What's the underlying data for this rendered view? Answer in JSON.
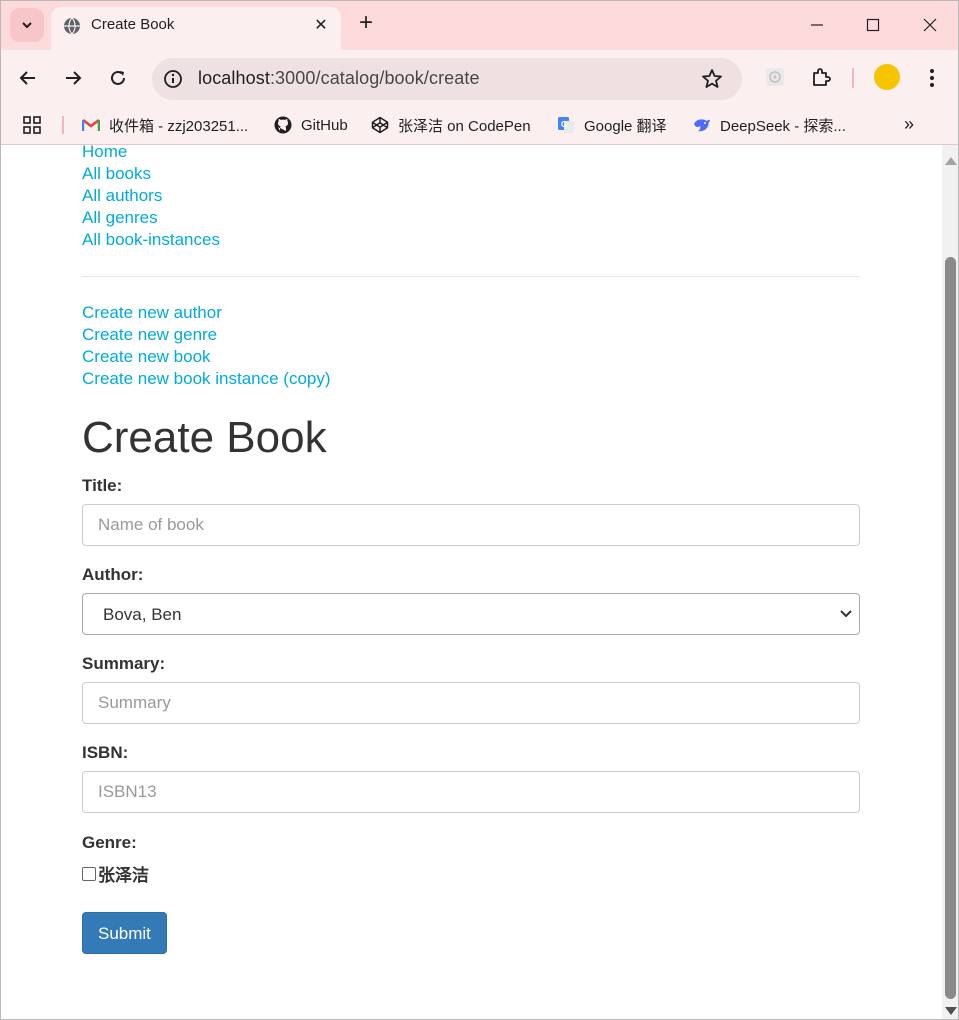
{
  "browser": {
    "tab_title": "Create Book",
    "url_host": "localhost",
    "url_rest": ":3000/catalog/book/create",
    "bookmarks": [
      {
        "label": "收件箱 - zzj203251..."
      },
      {
        "label": "GitHub"
      },
      {
        "label": "张泽洁 on CodePen"
      },
      {
        "label": "Google 翻译"
      },
      {
        "label": "DeepSeek - 探索..."
      }
    ],
    "icons": [
      "tab-list-icon",
      "globe-icon",
      "close-icon",
      "plus-icon",
      "minimize-icon",
      "maximize-icon",
      "close-window-icon",
      "back-icon",
      "forward-icon",
      "reload-icon",
      "site-info-icon",
      "star-icon",
      "extension-icon",
      "puzzle-icon",
      "profile-avatar",
      "more-icon",
      "apps-icon",
      "gmail-icon",
      "github-icon",
      "codepen-icon",
      "google-translate-icon",
      "deepseek-icon",
      "chevron-double-right-icon"
    ]
  },
  "nav": {
    "links": [
      "Home",
      "All books",
      "All authors",
      "All genres",
      "All book-instances"
    ]
  },
  "create": {
    "links": [
      "Create new author",
      "Create new genre",
      "Create new book",
      "Create new book instance (copy)"
    ]
  },
  "page": {
    "title": "Create Book"
  },
  "form": {
    "title_label": "Title:",
    "title_placeholder": "Name of book",
    "author_label": "Author:",
    "author_selected": "Bova, Ben",
    "summary_label": "Summary:",
    "summary_placeholder": "Summary",
    "isbn_label": "ISBN:",
    "isbn_placeholder": "ISBN13",
    "genre_label": "Genre:",
    "genres": [
      "张泽洁"
    ],
    "submit_label": "Submit"
  },
  "colors": {
    "link": "#00aadd",
    "button": "#337ab7",
    "tabbar": "#fddadc",
    "toolbar": "#fbeff0"
  }
}
